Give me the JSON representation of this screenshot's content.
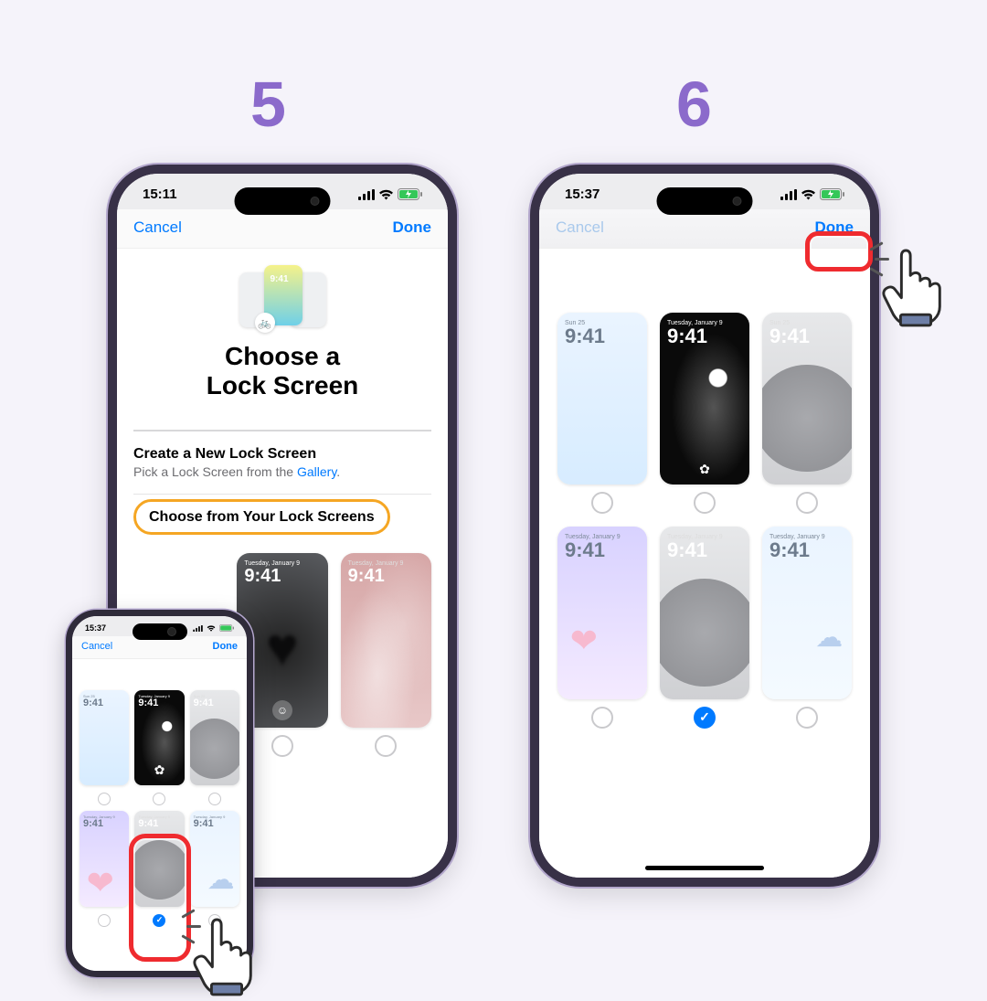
{
  "steps": {
    "s5": "5",
    "s6": "6"
  },
  "status": {
    "time5": "15:11",
    "time6": "15:37",
    "timeMini": "15:37"
  },
  "nav": {
    "cancel": "Cancel",
    "done": "Done"
  },
  "hero": {
    "title_l1": "Choose a",
    "title_l2": "Lock Screen",
    "preview_time": "9:41"
  },
  "create": {
    "title": "Create a New Lock Screen",
    "desc_pre": "Pick a Lock Screen from the ",
    "desc_link": "Gallery",
    "desc_post": "."
  },
  "choose_section": "Choose from Your Lock Screens",
  "thumb": {
    "date": "Tuesday, January 9",
    "date_short": "Sun 25",
    "time": "9:41"
  },
  "icons": {
    "signal": "signal-icon",
    "wifi": "wifi-icon",
    "battery": "battery-icon",
    "bike": "🚲",
    "smile": "☺",
    "paw": "✿",
    "check": "✓"
  },
  "colors": {
    "accent": "#007aff",
    "step": "#8b6acb",
    "highlight_border": "#f5a623",
    "callout": "#ef2b2f"
  }
}
